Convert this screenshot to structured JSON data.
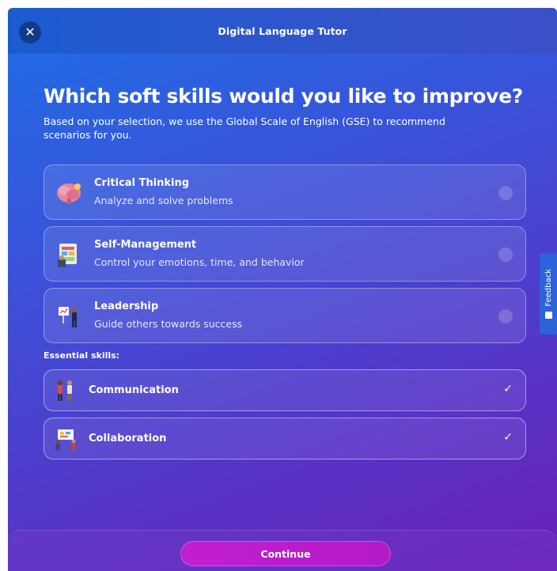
{
  "header": {
    "title": "Digital Language Tutor",
    "close_icon": "close-icon",
    "close_glyph": "✕"
  },
  "main": {
    "heading": "Which soft skills would you like to improve?",
    "subtext": "Based on your selection, we use the Global Scale of English (GSE) to recommend scenarios for you.",
    "options": [
      {
        "title": "Critical Thinking",
        "description": "Analyze and solve problems",
        "icon": "brain-icon",
        "selected": false
      },
      {
        "title": "Self-Management",
        "description": "Control your emotions, time, and behavior",
        "icon": "planner-icon",
        "selected": false
      },
      {
        "title": "Leadership",
        "description": "Guide others towards success",
        "icon": "presenter-icon",
        "selected": false
      }
    ],
    "essential_label": "Essential skills:",
    "essential": [
      {
        "label": "Communication",
        "icon": "people-talking-icon",
        "checked": true
      },
      {
        "label": "Collaboration",
        "icon": "team-board-icon",
        "checked": true
      }
    ],
    "check_glyph": "✓"
  },
  "footer": {
    "continue_label": "Continue"
  },
  "feedback": {
    "label": "Feedback"
  },
  "colors": {
    "accent": "#c21fcf",
    "gradient_start": "#1e6fe6",
    "gradient_end": "#6a1fb8"
  }
}
